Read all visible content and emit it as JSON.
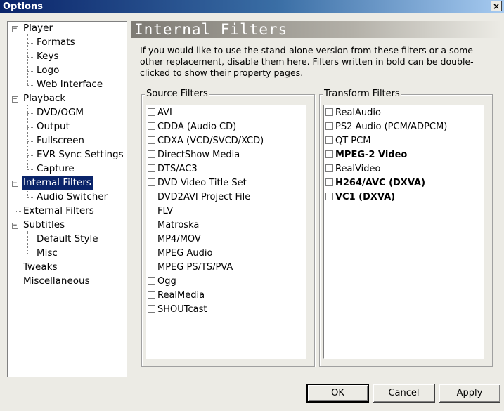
{
  "window": {
    "title": "Options",
    "close_glyph": "×"
  },
  "tree": {
    "items": [
      {
        "label": "Player",
        "expander": "−"
      },
      {
        "label": "Formats"
      },
      {
        "label": "Keys"
      },
      {
        "label": "Logo"
      },
      {
        "label": "Web Interface"
      },
      {
        "label": "Playback",
        "expander": "−"
      },
      {
        "label": "DVD/OGM"
      },
      {
        "label": "Output"
      },
      {
        "label": "Fullscreen"
      },
      {
        "label": "EVR Sync Settings"
      },
      {
        "label": "Capture"
      },
      {
        "label": "Internal Filters",
        "expander": "−",
        "selected": true
      },
      {
        "label": "Audio Switcher"
      },
      {
        "label": "External Filters"
      },
      {
        "label": "Subtitles",
        "expander": "−"
      },
      {
        "label": "Default Style"
      },
      {
        "label": "Misc"
      },
      {
        "label": "Tweaks"
      },
      {
        "label": "Miscellaneous"
      }
    ]
  },
  "page": {
    "title": "Internal Filters",
    "description": "If you would like to use the stand-alone version from these filters or a some other replacement, disable them here. Filters written in bold can be double-clicked to show their property pages."
  },
  "source_filters": {
    "label": "Source Filters",
    "items": [
      {
        "label": "AVI",
        "bold": false,
        "checked": false
      },
      {
        "label": "CDDA (Audio CD)",
        "bold": false,
        "checked": false
      },
      {
        "label": "CDXA (VCD/SVCD/XCD)",
        "bold": false,
        "checked": false
      },
      {
        "label": "DirectShow Media",
        "bold": false,
        "checked": false
      },
      {
        "label": "DTS/AC3",
        "bold": false,
        "checked": false
      },
      {
        "label": "DVD Video Title Set",
        "bold": false,
        "checked": false
      },
      {
        "label": "DVD2AVI Project File",
        "bold": false,
        "checked": false
      },
      {
        "label": "FLV",
        "bold": false,
        "checked": false
      },
      {
        "label": "Matroska",
        "bold": false,
        "checked": false
      },
      {
        "label": "MP4/MOV",
        "bold": false,
        "checked": false
      },
      {
        "label": "MPEG Audio",
        "bold": false,
        "checked": false
      },
      {
        "label": "MPEG PS/TS/PVA",
        "bold": false,
        "checked": false
      },
      {
        "label": "Ogg",
        "bold": false,
        "checked": false
      },
      {
        "label": "RealMedia",
        "bold": false,
        "checked": false
      },
      {
        "label": "SHOUTcast",
        "bold": false,
        "checked": false
      }
    ]
  },
  "transform_filters": {
    "label": "Transform Filters",
    "items": [
      {
        "label": "RealAudio",
        "bold": false,
        "checked": false
      },
      {
        "label": "PS2 Audio (PCM/ADPCM)",
        "bold": false,
        "checked": false
      },
      {
        "label": "QT PCM",
        "bold": false,
        "checked": false
      },
      {
        "label": "MPEG-2 Video",
        "bold": true,
        "checked": false
      },
      {
        "label": "RealVideo",
        "bold": false,
        "checked": false
      },
      {
        "label": "H264/AVC (DXVA)",
        "bold": true,
        "checked": false
      },
      {
        "label": "VC1 (DXVA)",
        "bold": true,
        "checked": false
      }
    ]
  },
  "buttons": {
    "ok": "OK",
    "cancel": "Cancel",
    "apply": "Apply"
  },
  "colors": {
    "selection": "#0a246a",
    "title_gradient_start": "#0a246a",
    "title_gradient_end": "#a6caf0",
    "face": "#ecebe5"
  }
}
